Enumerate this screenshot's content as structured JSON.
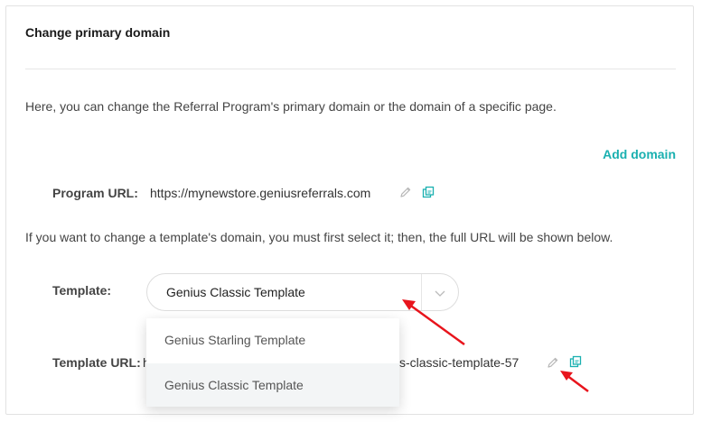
{
  "card": {
    "title": "Change primary domain",
    "description": "Here, you can change the Referral Program's primary domain or the domain of a specific page.",
    "add_domain_label": "Add domain"
  },
  "program_url": {
    "label": "Program URL:",
    "value": "https://mynewstore.geniusreferrals.com",
    "edit_icon": "pencil-icon",
    "copy_icon": "copy-icon"
  },
  "template_hint": "If you want to change a template's domain, you must first select it; then, the full URL will be shown below.",
  "template": {
    "label": "Template:",
    "selected": "Genius Classic Template",
    "options": [
      "Genius Starling Template",
      "Genius Classic Template"
    ],
    "highlighted_option": "Genius Classic Template"
  },
  "template_url": {
    "label": "Template URL:",
    "value_prefix_visible": "h",
    "value_suffix_visible": "s-classic-template-57",
    "edit_icon": "pencil-icon",
    "copy_icon": "copy-icon"
  },
  "colors": {
    "accent": "#1ab0b0",
    "annotation_arrow": "#e8141c"
  }
}
